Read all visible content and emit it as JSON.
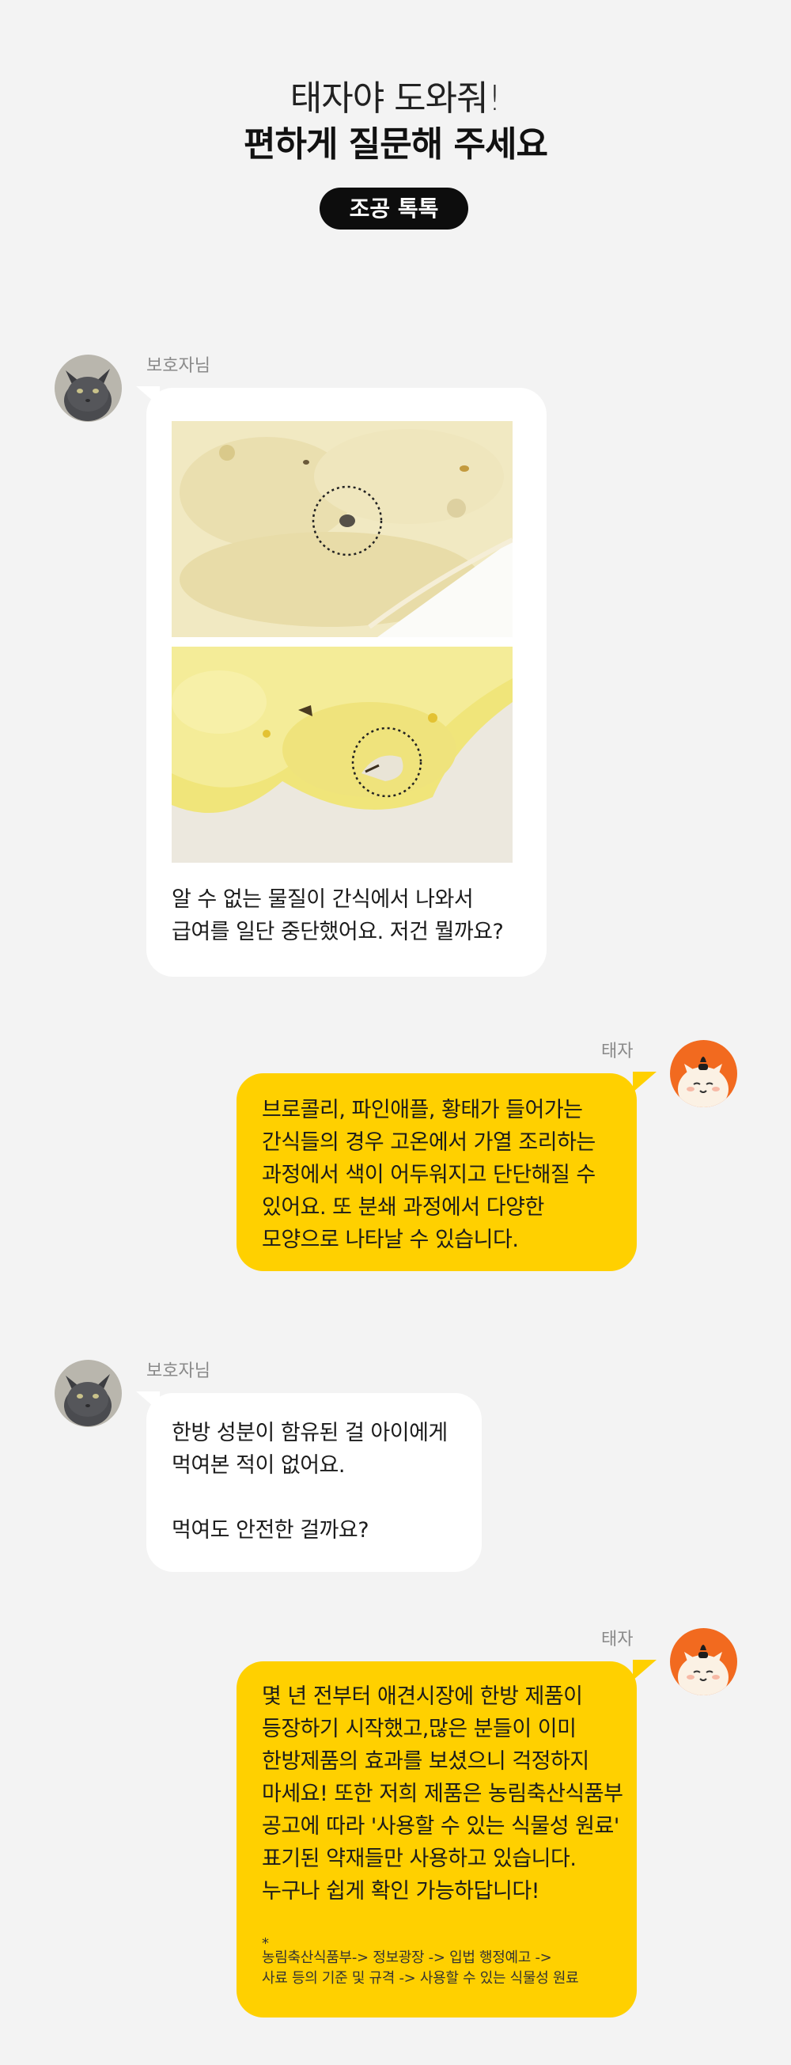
{
  "header": {
    "title_line1": "태자야 도와줘!",
    "title_line2": "편하게 질문해 주세요",
    "badge": "조공 톡톡"
  },
  "messages": [
    {
      "sender": "보호자님",
      "avatar": "gray-cat-avatar",
      "text": [
        "알 수 없는 물질이 간식에서 나와서",
        "급여를 일단 중단했어요. 저건 뭘까요?"
      ]
    },
    {
      "sender": "태자",
      "avatar": "cartoon-cat-avatar",
      "text": [
        "브로콜리, 파인애플, 황태가 들어가는",
        "간식들의 경우 고온에서 가열 조리하는",
        "과정에서 색이 어두워지고 단단해질 수",
        "있어요. 또 분쇄 과정에서 다양한",
        "모양으로 나타날 수 있습니다."
      ]
    },
    {
      "sender": "보호자님",
      "avatar": "gray-cat-avatar",
      "text": [
        "한방 성분이 함유된 걸 아이에게",
        "먹여본  적이 없어요.",
        "",
        "먹여도 안전한 걸까요?"
      ]
    },
    {
      "sender": "태자",
      "avatar": "cartoon-cat-avatar",
      "text": [
        "몇 년 전부터 애견시장에 한방 제품이",
        "등장하기 시작했고,많은 분들이 이미",
        "한방제품의 효과를 보셨으니 걱정하지",
        "마세요! 또한 저희 제품은 농림축산식품부",
        "공고에 따라 '사용할 수 있는 식물성 원료'",
        "표기된 약재들만 사용하고 있습니다.",
        "누구나 쉽게 확인 가능하답니다!"
      ],
      "note_bullet": "*",
      "note": [
        "농림축산식품부-> 정보광장 -> 입법 행정예고 ->",
        "사료 등의 기준 및 규격 -> 사용할 수 있는 식물성 원료"
      ]
    }
  ],
  "colors": {
    "background": "#f3f3f3",
    "user_bubble": "#ffffff",
    "reply_bubble": "#ffd000",
    "badge": "#0d0d0d",
    "reply_avatar_bg": "#f26a1f"
  }
}
